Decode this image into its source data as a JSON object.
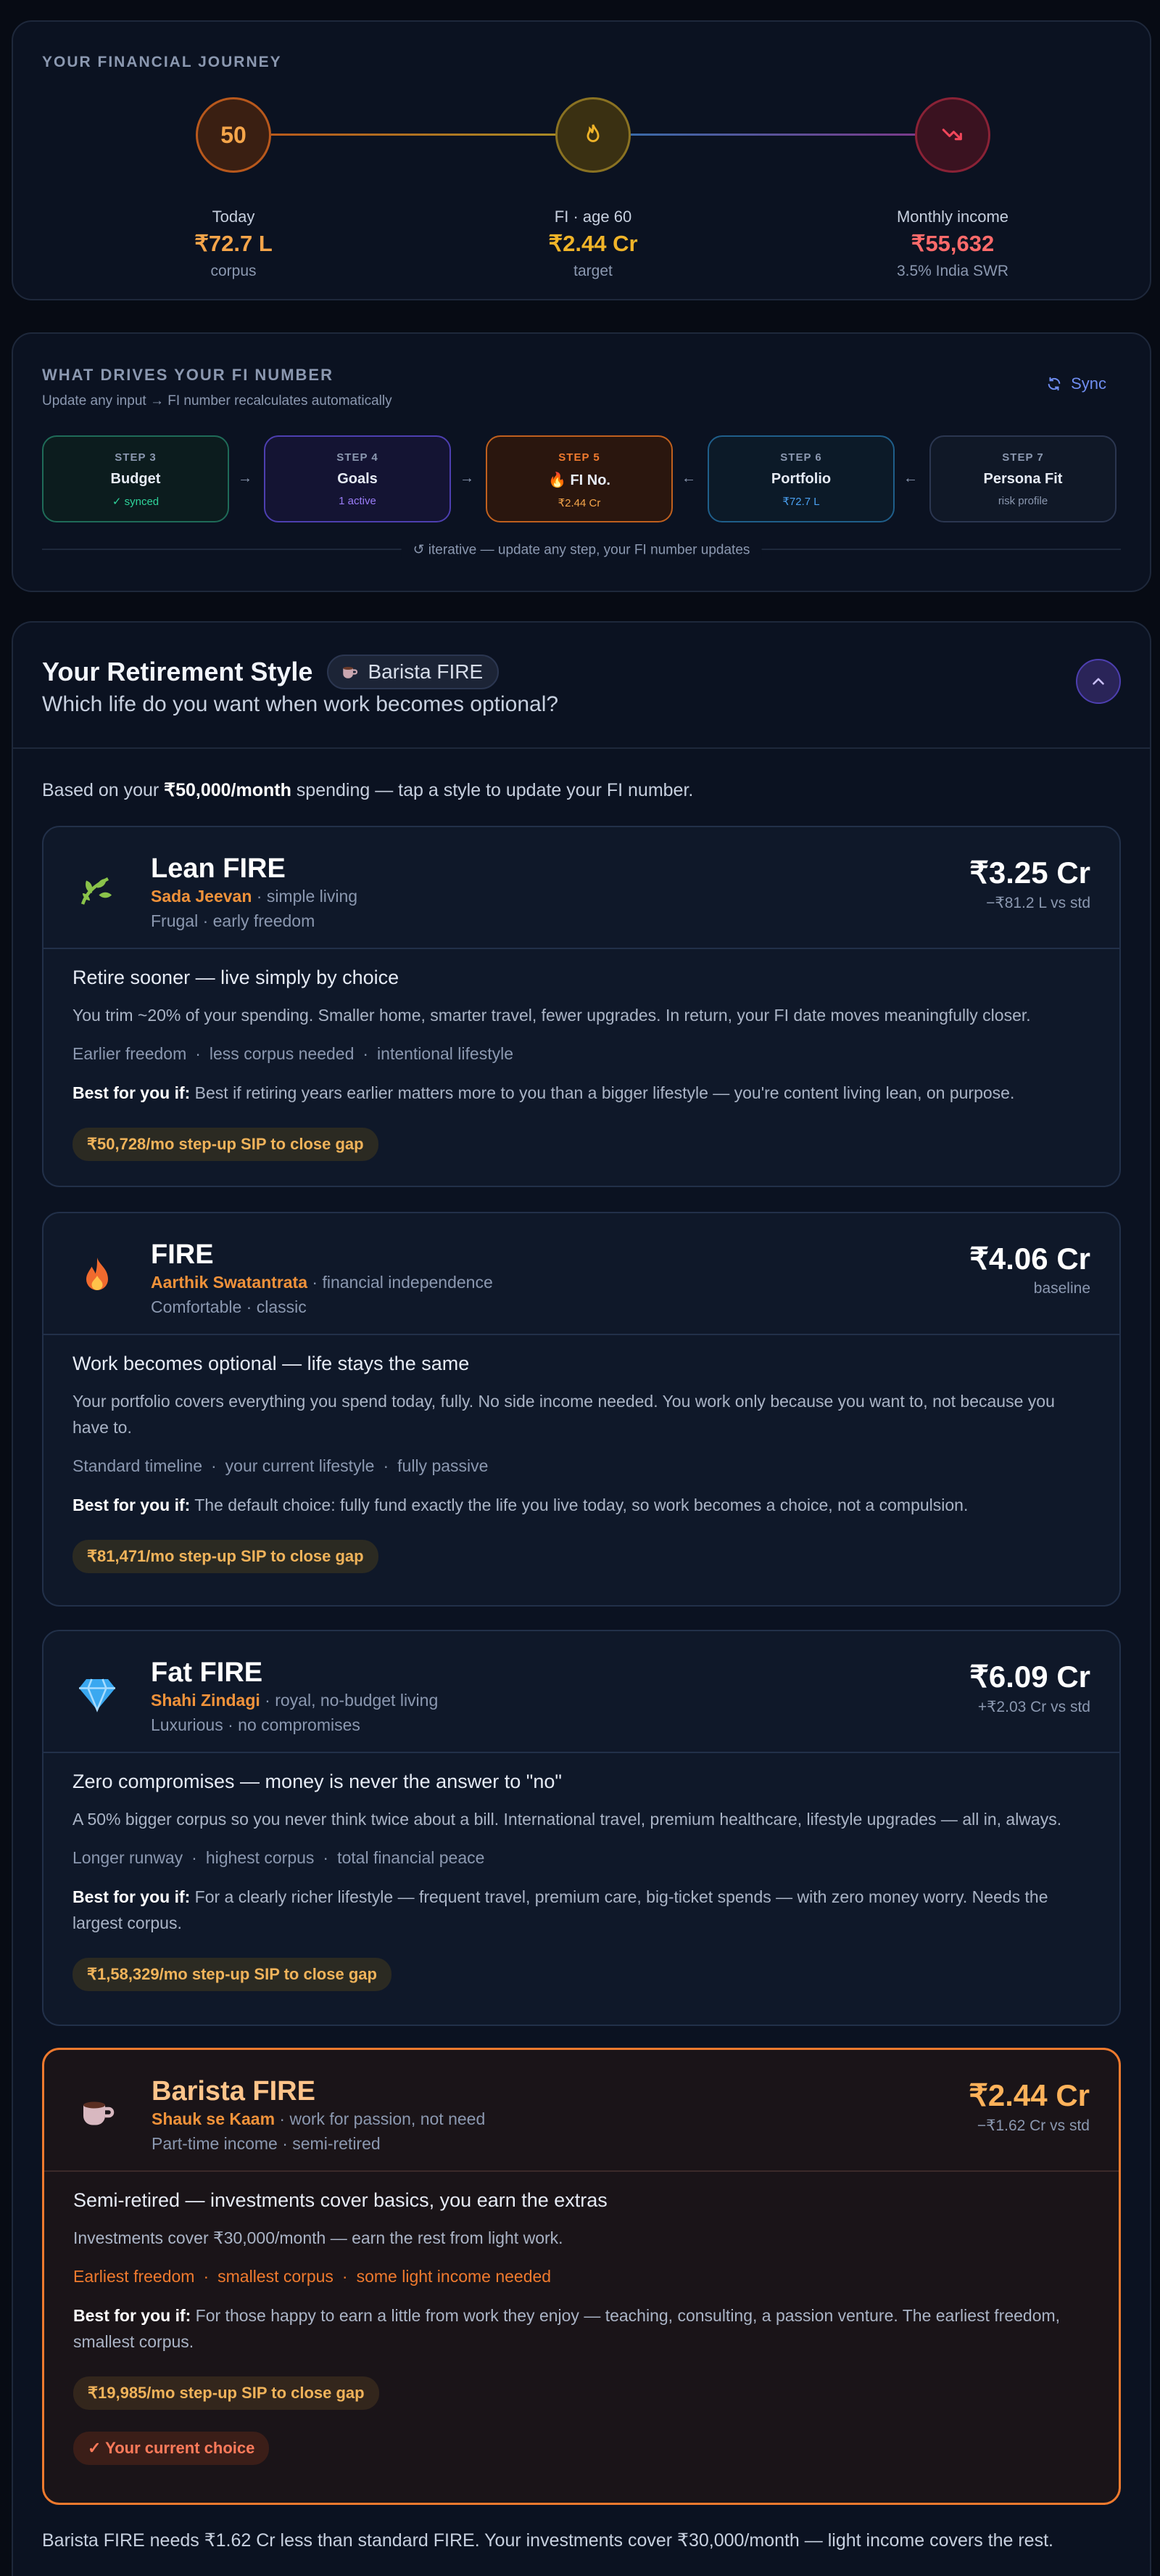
{
  "journey": {
    "title": "YOUR FINANCIAL JOURNEY",
    "nodes": [
      {
        "badge": "50",
        "label": "Today",
        "value": "₹72.7 L",
        "sub": "corpus",
        "color": "#f07a2e",
        "icon": "age-badge"
      },
      {
        "badge": "",
        "label": "FI · age 60",
        "value": "₹2.44 Cr",
        "sub": "target",
        "color": "#e0a92b",
        "icon": "flame-icon"
      },
      {
        "badge": "",
        "label": "Monthly income",
        "value": "₹55,632",
        "sub": "3.5% India SWR",
        "color": "#e0465a",
        "icon": "trend-down-icon"
      }
    ]
  },
  "drivers": {
    "title": "WHAT DRIVES YOUR FI NUMBER",
    "subtitle": "Update any input → FI number recalculates automatically",
    "sync_label": "Sync",
    "steps": [
      {
        "num": "STEP 3",
        "name": "Budget",
        "status": "✓ synced",
        "color": "#2fb38a"
      },
      {
        "num": "STEP 4",
        "name": "Goals",
        "status": "1 active",
        "color": "#7a5cf0"
      },
      {
        "num": "STEP 5",
        "name": "🔥 FI No.",
        "status": "₹2.44 Cr",
        "color": "#f07a2e"
      },
      {
        "num": "STEP 6",
        "name": "Portfolio",
        "status": "₹72.7 L",
        "color": "#3b8fd8"
      },
      {
        "num": "STEP 7",
        "name": "Persona Fit",
        "status": "risk profile",
        "color": "#4a5568"
      }
    ],
    "arrows": [
      "→",
      "→",
      "←",
      "←"
    ],
    "footer": "↺ iterative — update any step, your FI number updates"
  },
  "retirement": {
    "title": "Your Retirement Style",
    "selected_pill": "Barista FIRE",
    "question": "Which life do you want when work becomes optional?",
    "based_pre": "Based on your ",
    "based_amount": "₹50,000/month",
    "based_post": " spending — tap a style to update your FI number.",
    "cards": [
      {
        "icon": "leaf-icon",
        "name": "Lean FIRE",
        "hindi": "Sada Jeevan",
        "hindi_desc": " · simple living",
        "tags": "Frugal · early freedom",
        "amount": "₹3.25 Cr",
        "delta": "−₹81.2 L vs std",
        "headline": "Retire sooner — live simply by choice",
        "desc": "You trim ~20% of your spending. Smaller home, smarter travel, fewer upgrades. In return, your FI date moves meaningfully closer.",
        "chips": [
          "Earlier freedom",
          "less corpus needed",
          "intentional lifestyle"
        ],
        "best_label": "Best for you if:",
        "best": " Best if retiring years earlier matters more to you than a bigger lifestyle — you're content living lean, on purpose.",
        "sip": "₹50,728/mo step-up SIP to close gap"
      },
      {
        "icon": "flame-icon",
        "name": "FIRE",
        "hindi": "Aarthik Swatantrata",
        "hindi_desc": " · financial independence",
        "tags": "Comfortable · classic",
        "amount": "₹4.06 Cr",
        "delta": "baseline",
        "headline": "Work becomes optional — life stays the same",
        "desc": "Your portfolio covers everything you spend today, fully. No side income needed. You work only because you want to, not because you have to.",
        "chips": [
          "Standard timeline",
          "your current lifestyle",
          "fully passive"
        ],
        "best_label": "Best for you if:",
        "best": " The default choice: fully fund exactly the life you live today, so work becomes a choice, not a compulsion.",
        "sip": "₹81,471/mo step-up SIP to close gap"
      },
      {
        "icon": "diamond-icon",
        "name": "Fat FIRE",
        "hindi": "Shahi Zindagi",
        "hindi_desc": " · royal, no-budget living",
        "tags": "Luxurious · no compromises",
        "amount": "₹6.09 Cr",
        "delta": "+₹2.03 Cr vs std",
        "headline": "Zero compromises — money is never the answer to \"no\"",
        "desc": "A 50% bigger corpus so you never think twice about a bill. International travel, premium healthcare, lifestyle upgrades — all in, always.",
        "chips": [
          "Longer runway",
          "highest corpus",
          "total financial peace"
        ],
        "best_label": "Best for you if:",
        "best": " For a clearly richer lifestyle — frequent travel, premium care, big-ticket spends — with zero money worry. Needs the largest corpus.",
        "sip": "₹1,58,329/mo step-up SIP to close gap"
      },
      {
        "icon": "coffee-cup-icon",
        "name": "Barista FIRE",
        "hindi": "Shauk se Kaam",
        "hindi_desc": " · work for passion, not need",
        "tags": "Part-time income · semi-retired",
        "amount": "₹2.44 Cr",
        "delta": "−₹1.62 Cr vs std",
        "headline": "Semi-retired — investments cover basics, you earn the extras",
        "desc": "Investments cover ₹30,000/month — earn the rest from light work.",
        "chips": [
          "Earliest freedom",
          "smallest corpus",
          "some light income needed"
        ],
        "best_label": "Best for you if:",
        "best": " For those happy to earn a little from work they enjoy — teaching, consulting, a passion venture. The earliest freedom, smallest corpus.",
        "sip": "₹19,985/mo step-up SIP to close gap",
        "current": "✓ Your current choice"
      }
    ],
    "footnote": "Barista FIRE needs ₹1.62 Cr less than standard FIRE. Your investments cover ₹30,000/month — light income covers the rest."
  }
}
